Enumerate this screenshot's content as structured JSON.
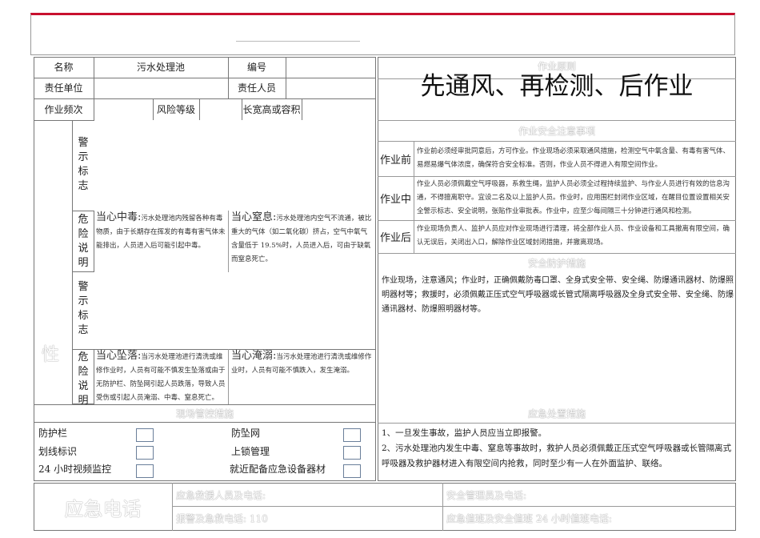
{
  "info": {
    "name_label": "名称",
    "name_value": "污水处理池",
    "number_label": "编号",
    "unit_label": "责任单位",
    "person_label": "责任人员",
    "freq_label": "作业频次",
    "risk_label": "风险等级",
    "size_label": "长宽高或容积"
  },
  "left": {
    "side_char": "性",
    "warning_sign": "警示标志",
    "danger_desc": "危险说明",
    "hazards": [
      {
        "title": "当心中毒:",
        "text": "污水处理池内残留各种有毒物质，由于长期存在挥发的有毒有害气体未能排出，人员进入后可能引起中毒。"
      },
      {
        "title": "当心窒息:",
        "text": "污水处理池内空气不流通，被比重大的气体（如二氧化碳）挤占，空气中氧气含量低于 19.5%时，人员进入后，可由于缺氧而窒息死亡。"
      },
      {
        "title": "当心坠落:",
        "text": "当污水处理池进行清洗或维修作业时，人员有可能不慎发生坠落或由于无防护栏、防坠网引起人员跌落，导致人员受伤或引起人员淹溺、中毒、窒息死亡。"
      },
      {
        "title": "当心淹溺:",
        "text": "当污水处理池进行清洗或维修作业时，人员有可能不慎跌入，发生淹溺。"
      }
    ],
    "controls_header": "现场管控措施",
    "controls": [
      "防护栏",
      "防坠网",
      "划线标识",
      "上锁管理",
      "24 小时视频监控",
      "就近配备应急设备器材"
    ]
  },
  "right": {
    "principle_header": "作业原则",
    "principle": "先通风、再检测、后作业",
    "safety_header": "作业安全注意事项",
    "stages": [
      {
        "label": "作业前",
        "text": "作业前必须经审批同意后，方可作业。作业现场必须采取通风措施，检测空气中氧含量、有毒有害气体、易燃易爆气体浓度，确保符合安全标准。否则，作业人员不得进入有限空间作业。"
      },
      {
        "label": "作业中",
        "text": "作业人员必须佩戴空气呼吸器，系救生绳，监护人员必须全过程持续监护、与作业人员进行有效的信息沟通，不得擅离职守。宜设二名及以上监护人员。作业时，应用围栏封闭作业区域，在醒目位置设置相关安全警示标志、安全说明，张贴作业审批表。作业中，应至少每间隔三十分钟进行通风和检测。"
      },
      {
        "label": "作业后",
        "text": "作业现场负责人、监护人员应对作业现场进行清理，将全部作业人员、作业设备和工具撤离有限空间，确认无误后，关闭出入口，解除作业区域封闭措施，并撤离现场。"
      }
    ],
    "protection_header": "安全防护措施",
    "protection": "作业现场，注意通风；作业时，正确佩戴防毒口罩、全身式安全带、安全绳、防爆通讯器材、防爆照明器材等；救援时，必须佩戴正压式空气呼吸器或长管式隔离呼吸器及全身式安全带、安全绳、防爆通讯器材、防爆照明器材等。",
    "emergency_header": "应急处置措施",
    "emergency": [
      "1、一旦发生事故，监护人员应当立即报警。",
      "2、污水处理池内发生中毒、窒息等事故时，救护人员必须佩戴正压式空气呼吸器或长管隔离式呼吸器及救护器材进入有限空间内抢救，同时至少有一人在外面监护、联络。"
    ]
  },
  "phones": {
    "title": "应急电话",
    "rescue": "应急救援人员及电话:",
    "safety_mgr": "安全管理员及电话:",
    "alarm": "报警及急救电话: 110",
    "duty": "应急值班及安全值班 24 小时值班电话:"
  },
  "colors": {
    "accent_red": "#c8102e"
  }
}
